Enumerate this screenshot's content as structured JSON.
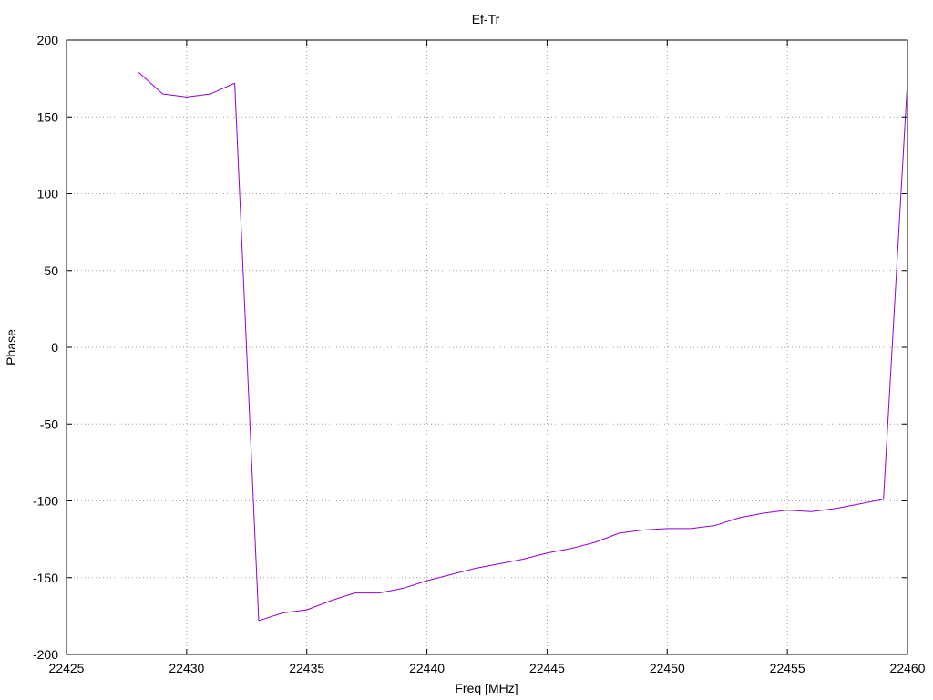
{
  "chart_data": {
    "type": "line",
    "title": "Ef-Tr",
    "xlabel": "Freq [MHz]",
    "ylabel": "Phase",
    "xlim": [
      22425,
      22460
    ],
    "ylim": [
      -200,
      200
    ],
    "xticks": [
      22425,
      22430,
      22435,
      22440,
      22445,
      22450,
      22455,
      22460
    ],
    "yticks": [
      -200,
      -150,
      -100,
      -50,
      0,
      50,
      100,
      150,
      200
    ],
    "grid": true,
    "legend": "none",
    "colors": {
      "series": "#9400d3",
      "frame": "#000000",
      "grid": "#a0a0a0",
      "background": "#ffffff"
    },
    "series": [
      {
        "x": [
          22428,
          22429,
          22430,
          22431,
          22432,
          22433,
          22434,
          22435,
          22436,
          22437,
          22438,
          22439,
          22440,
          22441,
          22442,
          22443,
          22444,
          22445,
          22446,
          22447,
          22448,
          22449,
          22450,
          22451,
          22452,
          22453,
          22454,
          22455,
          22456,
          22457,
          22458,
          22459,
          22460
        ],
        "y": [
          179,
          165,
          163,
          165,
          172,
          -178,
          -173,
          -171,
          -165,
          -160,
          -160,
          -157,
          -152,
          -148,
          -144,
          -141,
          -138,
          -134,
          -131,
          -127,
          -121,
          -119,
          -118,
          -118,
          -116,
          -111,
          -108,
          -106,
          -107,
          -105,
          -102,
          -99,
          174
        ]
      }
    ]
  }
}
